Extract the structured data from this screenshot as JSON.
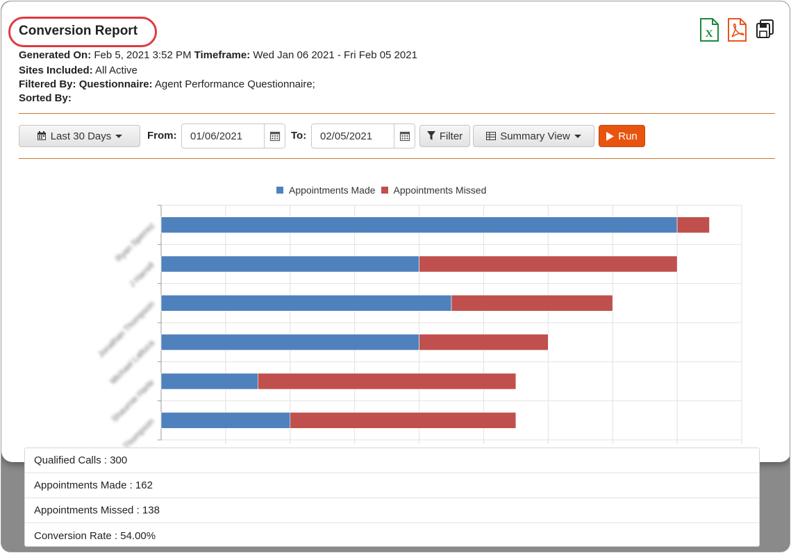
{
  "report": {
    "title": "Conversion Report",
    "generated_on_label": "Generated On:",
    "generated_on": "Feb 5, 2021 3:52 PM",
    "timeframe_label": "Timeframe:",
    "timeframe": "Wed Jan 06 2021 - Fri Feb 05 2021",
    "sites_label": "Sites Included:",
    "sites": "All Active",
    "filtered_label": "Filtered By:",
    "questionnaire_label": "Questionnaire:",
    "questionnaire": "Agent Performance Questionnaire;",
    "sorted_label": "Sorted By:"
  },
  "export_icons": [
    "excel-icon",
    "pdf-icon",
    "save-icon"
  ],
  "toolbar": {
    "range_label": "Last 30 Days",
    "from_label": "From:",
    "from_value": "01/06/2021",
    "to_label": "To:",
    "to_value": "02/05/2021",
    "filter_label": "Filter",
    "view_label": "Summary View",
    "run_label": "Run"
  },
  "colors": {
    "made": "#4f81bd",
    "missed": "#c0504d",
    "run": "#e8540f",
    "title_highlight": "#e03a3e"
  },
  "chart_data": {
    "type": "bar",
    "orientation": "horizontal",
    "stacked": true,
    "categories": [
      "Ryan Sperrez",
      "J Harrell",
      "Jonathan Thompson",
      "Michael Lattuca",
      "Shaurnie Harte",
      "Thompson"
    ],
    "series": [
      {
        "name": "Appointments Made",
        "values": [
          40,
          20,
          22.5,
          20,
          7.5,
          10
        ]
      },
      {
        "name": "Appointments Missed",
        "values": [
          2.5,
          20,
          12.5,
          10,
          20,
          17.5
        ]
      }
    ],
    "xlim": [
      0,
      45
    ],
    "grid": true,
    "legend": "top-center"
  },
  "summary": {
    "rows": [
      "Qualified Calls : 300",
      "Appointments Made : 162",
      "Appointments Missed : 138",
      "Conversion Rate : 54.00%"
    ]
  }
}
